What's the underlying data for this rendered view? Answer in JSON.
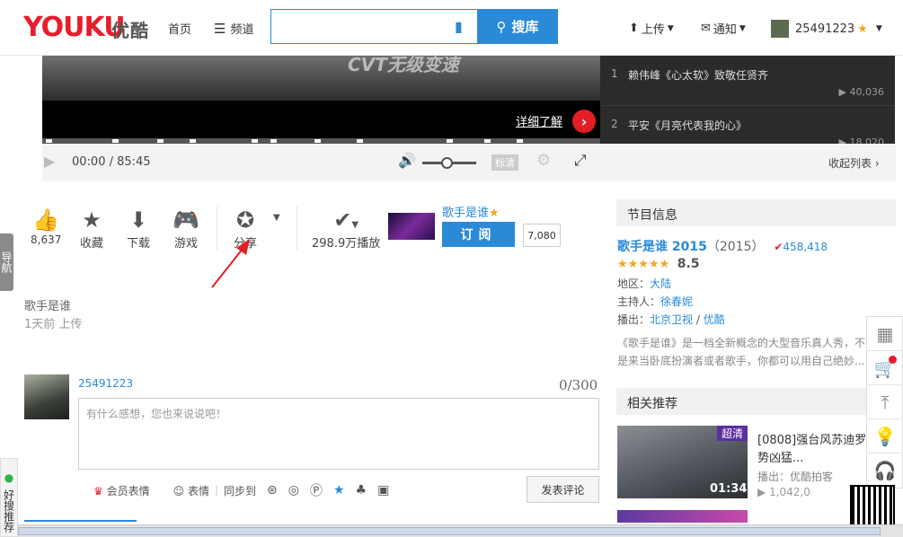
{
  "header": {
    "logo_en": "YOUKU",
    "logo_cn": "优酷",
    "nav_home": "首页",
    "nav_channel": "频道",
    "search_placeholder": "",
    "search_button": "搜库",
    "upload": "上传",
    "notify": "通知",
    "username": "25491223"
  },
  "player": {
    "caption": "CVT无级变速",
    "more_link": "详细了解",
    "time": "00:00 / 85:45",
    "quality": "标清",
    "collapse": "收起列表"
  },
  "playlist": [
    {
      "num": "1",
      "title": "赖伟峰《心太软》致敬任贤齐",
      "views": "40,036"
    },
    {
      "num": "2",
      "title": "平安《月亮代表我的心》",
      "views": "18,020"
    }
  ],
  "side_tab": "导航",
  "actions": {
    "like_count": "8,637",
    "favorite": "收藏",
    "download": "下载",
    "game": "游戏",
    "share": "分享",
    "plays": "298.9万播放",
    "channel_name": "歌手是谁",
    "subscribe": "订阅",
    "sub_count": "7,080"
  },
  "video": {
    "title": "歌手是谁",
    "uploaded": "1天前 上传"
  },
  "comment": {
    "username": "25491223",
    "counter": "0/300",
    "placeholder": "有什么感想，您也来说说吧！",
    "vip_emoji": "会员表情",
    "emoji": "表情",
    "sync": "同步到",
    "post": "发表评论"
  },
  "program": {
    "heading": "节目信息",
    "title": "歌手是谁 2015",
    "year": "（2015）",
    "plays": "458,418",
    "rating": "8.5",
    "rating_stars": 4.5,
    "region_label": "地区：",
    "region": "大陆",
    "host_label": "主持人：",
    "host": "徐春妮",
    "broadcast_label": "播出：",
    "broadcast_a": "北京卫视",
    "broadcast_sep": "/",
    "broadcast_b": "优酷",
    "desc1": "《歌手是谁》是一档全新概念的大型音乐真人秀，不",
    "desc2": "是来当卧底扮演者或者歌手，你都可以用自己绝妙..."
  },
  "recommend": {
    "heading": "相关推荐",
    "badge": "超清",
    "duration": "01:34",
    "title1": "[0808]强台风苏迪罗",
    "title2": "势凶猛...",
    "by": "播出：优酷拍客",
    "views": "1,042,0"
  },
  "haosou": "好搜推荐",
  "colors": {
    "brand_blue": "#2a8ad8",
    "brand_red": "#e61e2b",
    "star": "#f5a623"
  }
}
